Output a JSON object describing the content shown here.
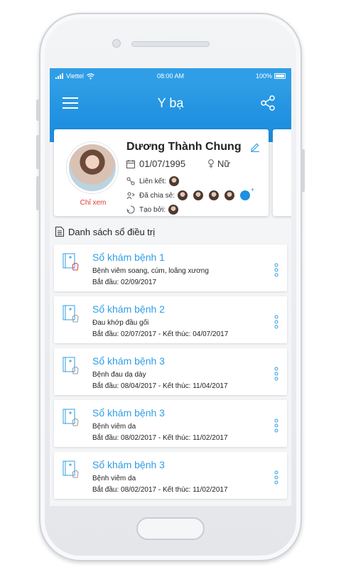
{
  "status_bar": {
    "carrier": "Viettel",
    "time": "08:00 AM",
    "battery": "100%"
  },
  "app_bar": {
    "title": "Y bạ"
  },
  "profile": {
    "name": "Dương Thành Chung",
    "dob": "01/07/1995",
    "gender": "Nữ",
    "view_only": "Chỉ xem",
    "linked_label": "Liên kết:",
    "shared_label": "Đã chia sẻ:",
    "created_label": "Tạo bởi:"
  },
  "section": {
    "title": "Danh sách sổ điều trị"
  },
  "records": [
    {
      "title": "Sổ khám bệnh 1",
      "desc": "Bệnh viêm soang, cúm, loãng xương",
      "dates": "Bắt đầu: 02/09/2017"
    },
    {
      "title": "Sổ khám bệnh 2",
      "desc": "Đau khớp đầu gối",
      "dates": "Bắt đầu: 02/07/2017 - Kết thúc: 04/07/2017"
    },
    {
      "title": "Sổ khám bệnh 3",
      "desc": "Bệnh đau dạ dày",
      "dates": "Bắt đầu: 08/04/2017 - Kết thúc: 11/04/2017"
    },
    {
      "title": "Sổ khám bệnh 3",
      "desc": "Bệnh viêm da",
      "dates": "Bắt đầu: 08/02/2017 - Kết thúc: 11/02/2017"
    },
    {
      "title": "Sổ khám bệnh 3",
      "desc": "Bệnh viêm da",
      "dates": "Bắt đầu: 08/02/2017 - Kết thúc: 11/02/2017"
    }
  ],
  "colors": {
    "primary": "#2f9ee6",
    "accent_red": "#e23b3b"
  }
}
